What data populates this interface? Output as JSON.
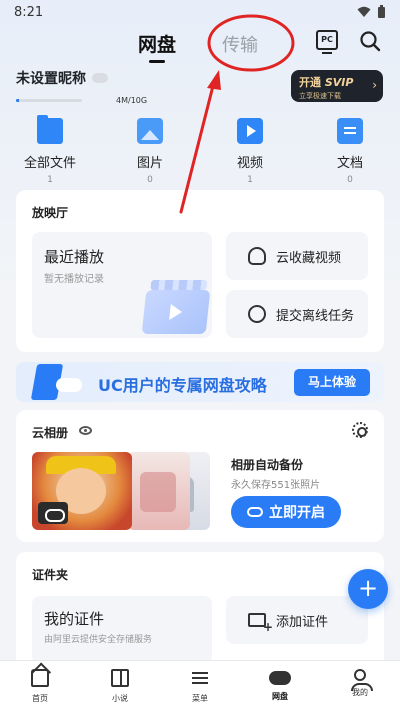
{
  "status": {
    "time": "8:21"
  },
  "header": {
    "tab_active": "网盘",
    "tab_transfer": "传输",
    "pc_label": "PC"
  },
  "profile": {
    "nickname": "未设置昵称",
    "storage_text": "4M/10G",
    "storage_used_fraction": 0.0004
  },
  "svip": {
    "title_prefix": "开通 ",
    "title_vip": "SVIP",
    "subtitle": "立享极速下载",
    "arrow": "›"
  },
  "quick": [
    {
      "label": "全部文件",
      "count": "1",
      "icon": "folder-icon"
    },
    {
      "label": "图片",
      "count": "0",
      "icon": "image-icon"
    },
    {
      "label": "视频",
      "count": "1",
      "icon": "video-icon"
    },
    {
      "label": "文档",
      "count": "0",
      "icon": "document-icon"
    }
  ],
  "theater": {
    "title": "放映厅",
    "recent_title": "最近播放",
    "recent_sub": "暂无播放记录",
    "action1": "云收藏视频",
    "action2": "提交离线任务"
  },
  "banner": {
    "text": "UC用户的专属网盘攻略",
    "button": "马上体验"
  },
  "album": {
    "title": "云相册",
    "backup_title": "相册自动备份",
    "backup_sub": "永久保存551张照片",
    "backup_button": "立即开启"
  },
  "cert": {
    "title": "证件夹",
    "mycert_title": "我的证件",
    "mycert_sub": "由阿里云提供安全存储服务",
    "add_label": "添加证件"
  },
  "fab": {
    "label": "+"
  },
  "nav": [
    {
      "label": "首页",
      "icon": "home-icon"
    },
    {
      "label": "小说",
      "icon": "book-icon"
    },
    {
      "label": "菜单",
      "icon": "menu-icon"
    },
    {
      "label": "网盘",
      "icon": "cloud-icon"
    },
    {
      "label": "我的",
      "icon": "profile-icon"
    }
  ],
  "colors": {
    "accent": "#2a7cf6",
    "annotation": "#e02424",
    "svip_bg": "#1f232b",
    "svip_text": "#f1d39a"
  }
}
